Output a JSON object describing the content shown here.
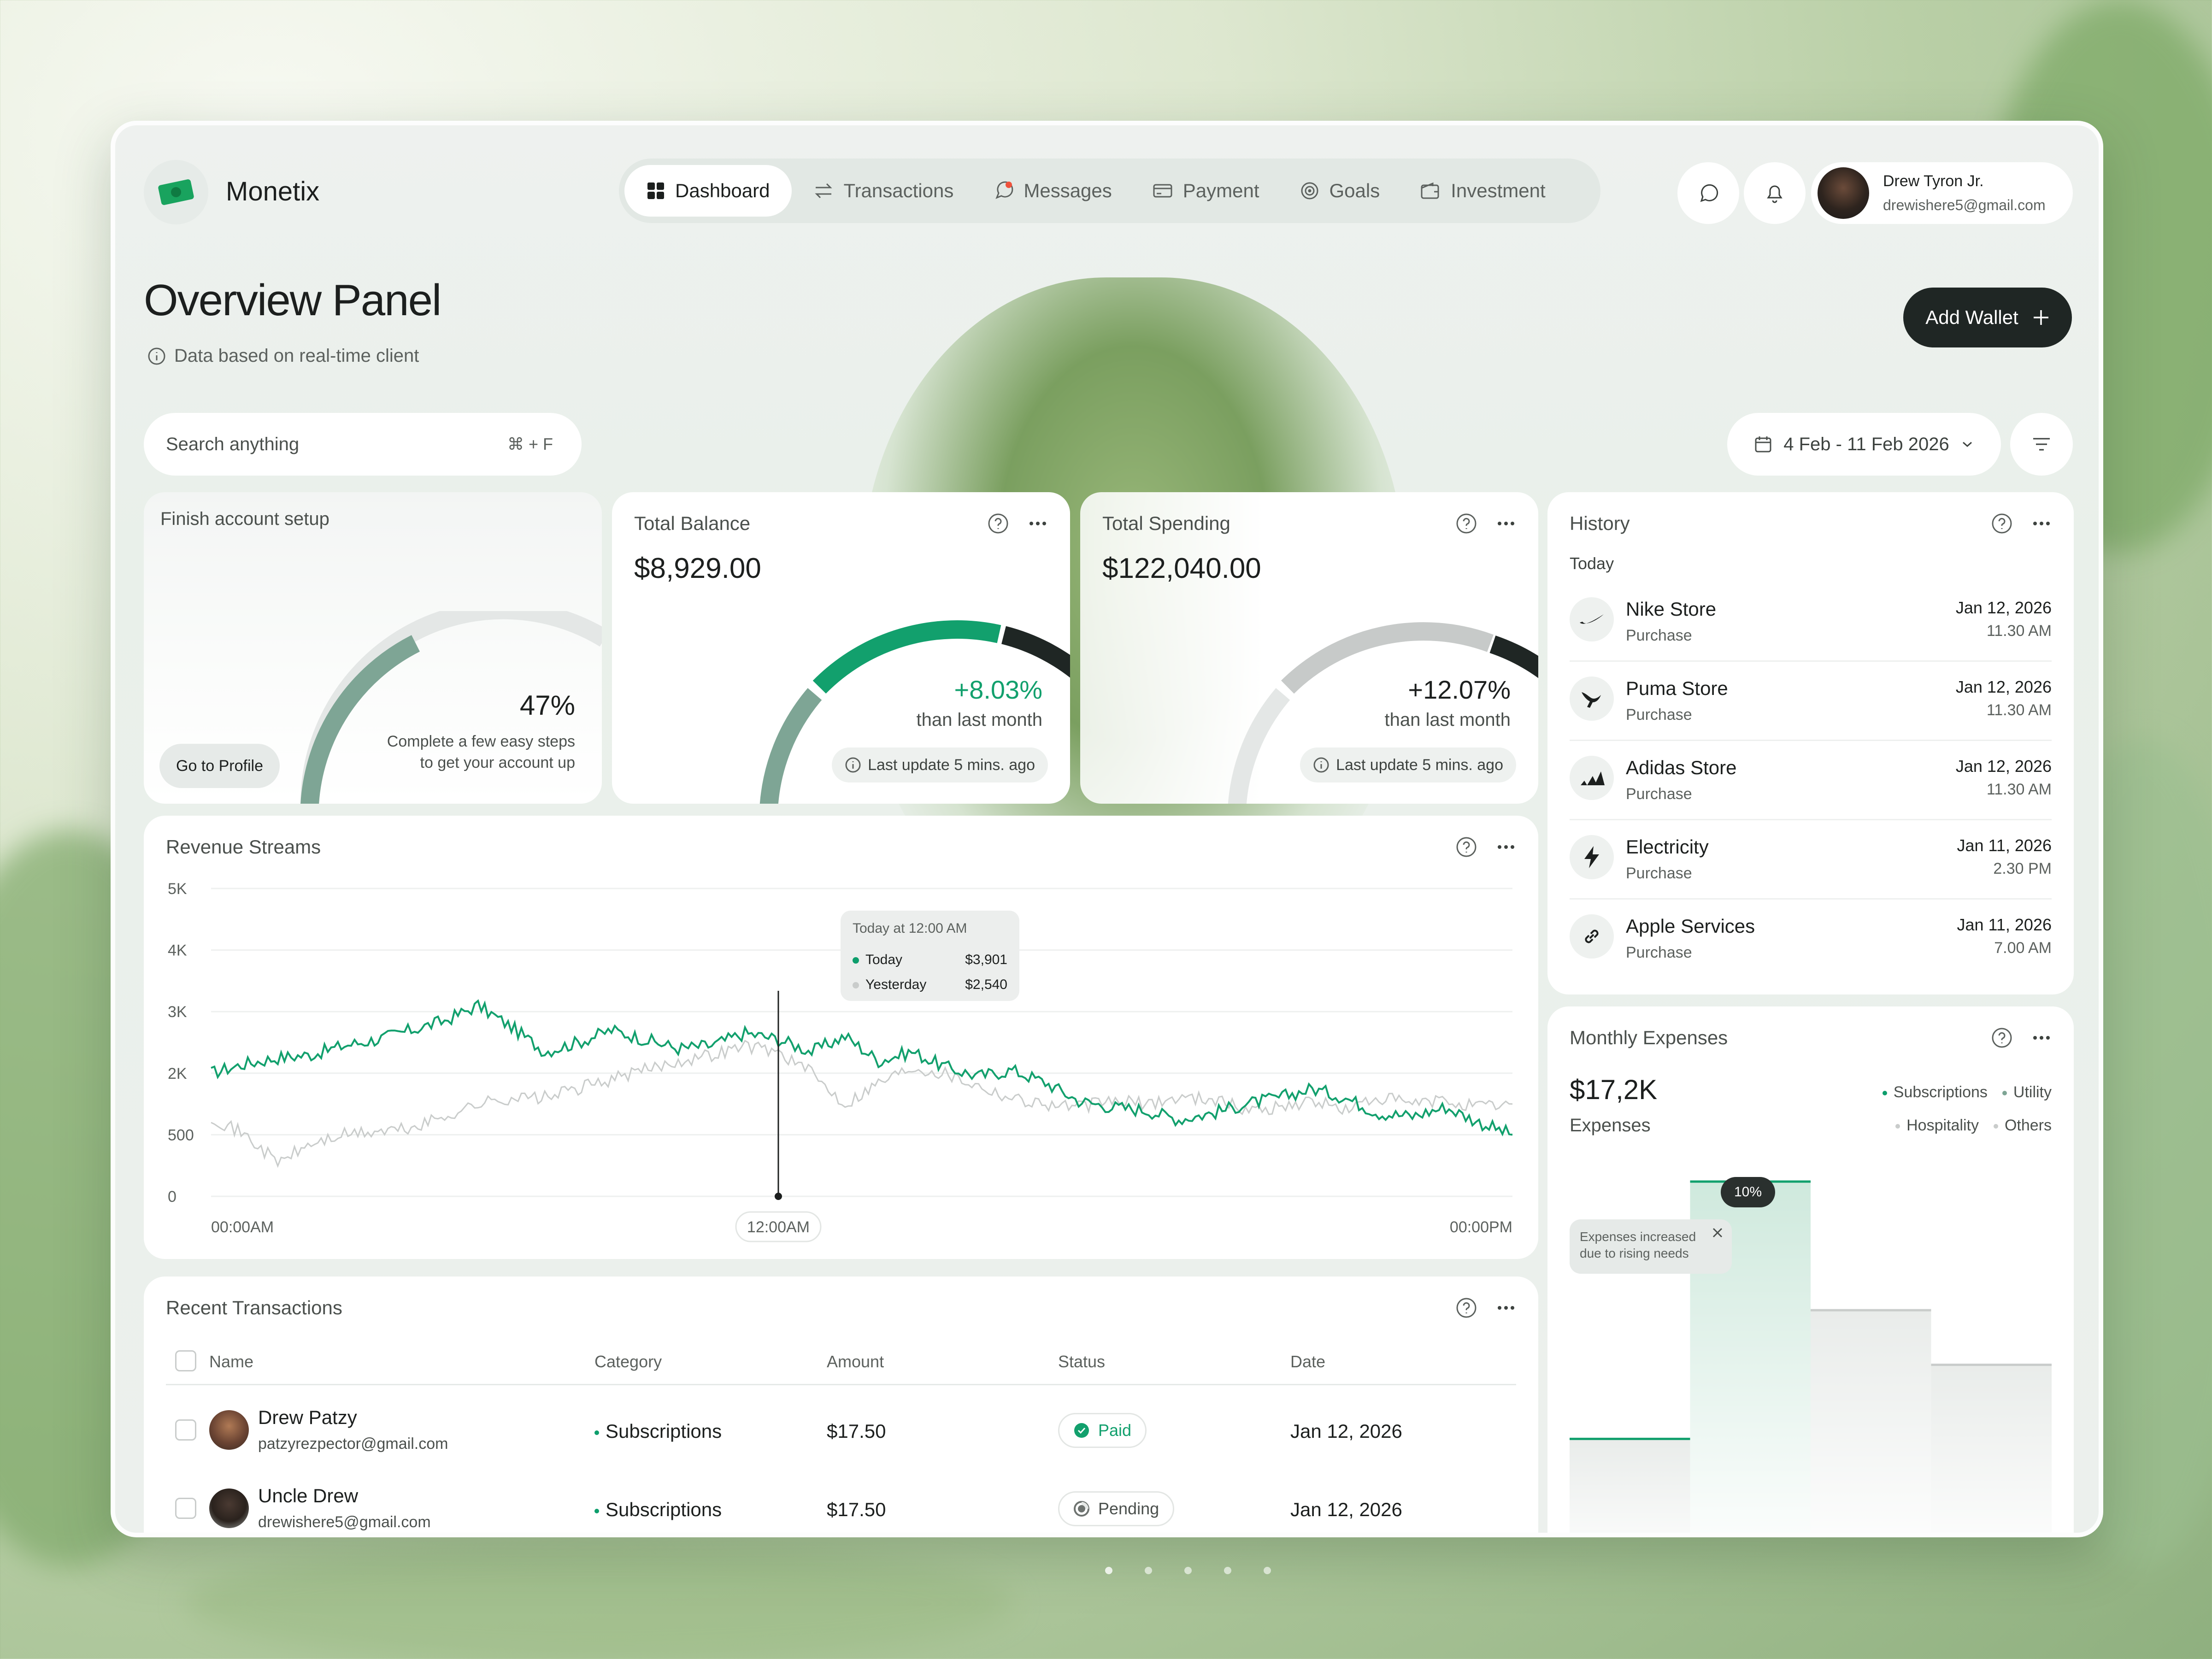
{
  "app": {
    "name": "Monetix"
  },
  "nav": {
    "tabs": [
      {
        "label": "Dashboard",
        "icon": "grid-icon",
        "active": true
      },
      {
        "label": "Transactions",
        "icon": "arrows-swap-icon"
      },
      {
        "label": "Messages",
        "icon": "chat-bubble-icon"
      },
      {
        "label": "Payment",
        "icon": "card-icon"
      },
      {
        "label": "Goals",
        "icon": "target-icon"
      },
      {
        "label": "Investment",
        "icon": "wallet-icon"
      }
    ]
  },
  "user": {
    "name": "Drew Tyron Jr.",
    "email": "drewishere5@gmail.com"
  },
  "page": {
    "title": "Overview Panel",
    "subtitle": "Data based on real-time client",
    "add_wallet": "Add Wallet"
  },
  "search": {
    "placeholder": "Search anything",
    "shortcut": "⌘ + F"
  },
  "date_range": "4 Feb -  11 Feb 2026",
  "setup": {
    "title": "Finish account setup",
    "percent": "47%",
    "percent_value": 0.47,
    "desc_1": "Complete a few easy steps",
    "desc_2": "to get your account up",
    "button": "Go to Profile"
  },
  "balance": {
    "title": "Total Balance",
    "value": "$8,929.00",
    "change": "+8.03%",
    "note": "than last month",
    "update": "Last update 5 mins. ago"
  },
  "spending": {
    "title": "Total Spending",
    "value": "$122,040.00",
    "change": "+12.07%",
    "note": "than last month",
    "update": "Last update 5 mins. ago"
  },
  "history": {
    "title": "History",
    "group": "Today",
    "items": [
      {
        "name": "Nike Store",
        "type": "Purchase",
        "date": "Jan 12, 2026",
        "time": "11.30 AM",
        "icon": "nike-icon"
      },
      {
        "name": "Puma Store",
        "type": "Purchase",
        "date": "Jan 12, 2026",
        "time": "11.30 AM",
        "icon": "puma-icon"
      },
      {
        "name": "Adidas Store",
        "type": "Purchase",
        "date": "Jan 12, 2026",
        "time": "11.30 AM",
        "icon": "adidas-icon"
      },
      {
        "name": "Electricity",
        "type": "Purchase",
        "date": "Jan 11, 2026",
        "time": "2.30 PM",
        "icon": "lightning-icon"
      },
      {
        "name": "Apple Services",
        "type": "Purchase",
        "date": "Jan 11, 2026",
        "time": "7.00 AM",
        "icon": "link-icon"
      }
    ]
  },
  "revenue": {
    "title": "Revenue Streams",
    "tooltip": {
      "title": "Today at 12:00 AM",
      "today_label": "Today",
      "today_value": "$3,901",
      "yesterday_label": "Yesterday",
      "yesterday_value": "$2,540"
    }
  },
  "chart_data": {
    "type": "line",
    "title": "Revenue Streams",
    "y_ticks": [
      "5K",
      "4K",
      "3K",
      "2K",
      "500",
      "0"
    ],
    "x_ticks": [
      "00:00AM",
      "12:00AM",
      "00:00PM"
    ],
    "series": [
      {
        "name": "Today",
        "color": "#12a06d",
        "values": [
          2.0,
          2.15,
          2.25,
          2.3,
          2.45,
          2.55,
          2.7,
          2.85,
          3.1,
          2.75,
          2.35,
          2.5,
          2.7,
          2.55,
          2.4,
          2.45,
          2.65,
          2.55,
          2.35,
          2.6,
          2.2,
          2.35,
          2.1,
          1.95,
          2.05,
          1.85,
          1.55,
          1.45,
          1.4,
          1.25,
          1.35,
          1.5,
          1.6,
          1.75,
          1.6,
          1.35,
          1.3,
          1.45,
          1.2,
          1.0
        ]
      },
      {
        "name": "Yesterday",
        "color": "#c9cccb",
        "values": [
          1.3,
          1.0,
          0.55,
          0.85,
          1.0,
          1.05,
          1.1,
          1.3,
          1.5,
          1.6,
          1.6,
          1.75,
          1.9,
          2.05,
          2.2,
          2.3,
          2.45,
          2.35,
          2.0,
          1.5,
          1.85,
          2.1,
          2.0,
          1.8,
          1.6,
          1.5,
          1.45,
          1.55,
          1.5,
          1.6,
          1.6,
          1.4,
          1.45,
          1.55,
          1.4,
          1.6,
          1.5,
          1.55,
          1.45,
          1.5
        ]
      }
    ],
    "highlight_index": 17
  },
  "transactions": {
    "title": "Recent Transactions",
    "columns": [
      "Name",
      "Category",
      "Amount",
      "Status",
      "Date"
    ],
    "rows": [
      {
        "name": "Drew Patzy",
        "email": "patzyrezpector@gmail.com",
        "category": "Subscriptions",
        "amount": "$17.50",
        "status": "Paid",
        "date": "Jan 12, 2026"
      },
      {
        "name": "Uncle Drew",
        "email": "drewishere5@gmail.com",
        "category": "Subscriptions",
        "amount": "$17.50",
        "status": "Pending",
        "date": "Jan 12, 2026"
      }
    ]
  },
  "expenses": {
    "title": "Monthly Expenses",
    "value": "$17,2K",
    "label": "Expenses",
    "legend": [
      "Subscriptions",
      "Utility",
      "Hospitality",
      "Others"
    ],
    "badge": "10%",
    "note_1": "Expenses increased",
    "note_2": "due to rising needs",
    "bars": [
      {
        "name": "Subscriptions",
        "level": 0.34
      },
      {
        "name": "Utility",
        "level": 1.0
      },
      {
        "name": "Hospitality",
        "level": 0.67
      },
      {
        "name": "Others",
        "level": 0.53
      }
    ]
  },
  "colors": {
    "accent": "#12a06d",
    "dark": "#1f2624"
  }
}
